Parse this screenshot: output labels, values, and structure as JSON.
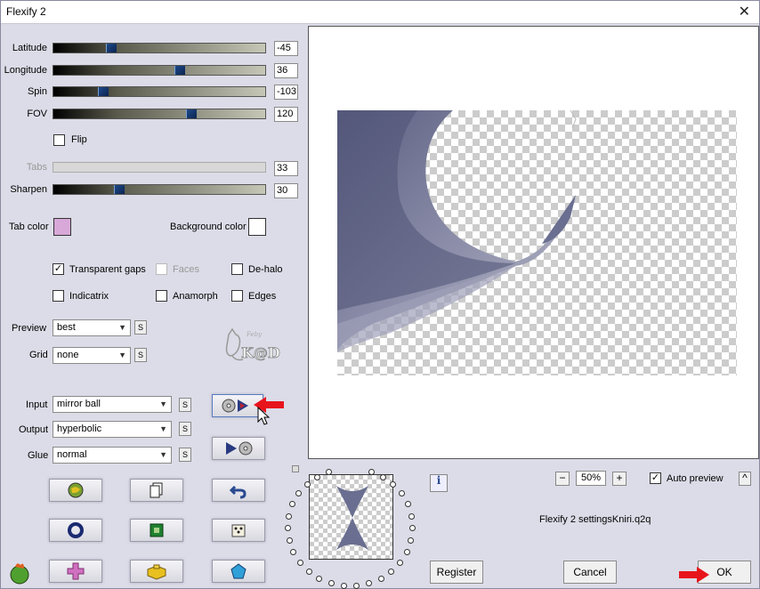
{
  "window": {
    "title": "Flexify 2",
    "close_glyph": "✕"
  },
  "sliders": [
    {
      "label": "Latitude",
      "value": "-45",
      "fraction": 0.26
    },
    {
      "label": "Longitude",
      "value": "36",
      "fraction": 0.6
    },
    {
      "label": "Spin",
      "value": "-103",
      "fraction": 0.22
    },
    {
      "label": "FOV",
      "value": "120",
      "fraction": 0.66
    },
    {
      "label": "Tabs",
      "value": "33",
      "fraction": 0,
      "disabled": true
    },
    {
      "label": "Sharpen",
      "value": "30",
      "fraction": 0.3
    }
  ],
  "flip": {
    "label": "Flip",
    "checked": false
  },
  "colors": {
    "tab_color_label": "Tab color",
    "tab_color": "#d8a8d8",
    "background_color_label": "Background color",
    "background_color": "#ffffff"
  },
  "checkboxes": {
    "transparent_gaps": {
      "label": "Transparent gaps",
      "checked": true,
      "mark": "✓"
    },
    "faces": {
      "label": "Faces",
      "checked": false,
      "disabled": true
    },
    "dehalo": {
      "label": "De-halo",
      "checked": false
    },
    "indicatrix": {
      "label": "Indicatrix",
      "checked": false
    },
    "anamorph": {
      "label": "Anamorph",
      "checked": false
    },
    "edges": {
      "label": "Edges",
      "checked": false
    }
  },
  "selects": {
    "preview": {
      "label": "Preview",
      "value": "best"
    },
    "grid": {
      "label": "Grid",
      "value": "none"
    },
    "input": {
      "label": "Input",
      "value": "mirror ball"
    },
    "output": {
      "label": "Output",
      "value": "hyperbolic"
    },
    "glue": {
      "label": "Glue",
      "value": "normal"
    },
    "s_label": "S",
    "arrow_glyph": "▼"
  },
  "watermark": {
    "text": "K@D",
    "small": "Feby"
  },
  "zoom": {
    "minus": "−",
    "value": "50%",
    "plus": "+"
  },
  "auto_preview": {
    "label": "Auto preview",
    "checked": true,
    "mark": "✓",
    "collapse_glyph": "^"
  },
  "info_glyph": "i",
  "settings_file": "Flexify 2 settingsKniri.q2q",
  "buttons": {
    "register": "Register",
    "cancel": "Cancel",
    "ok": "OK"
  },
  "accent": {
    "red_arrow": "#e8141c",
    "thumb_blue": "#1e4a8a"
  }
}
